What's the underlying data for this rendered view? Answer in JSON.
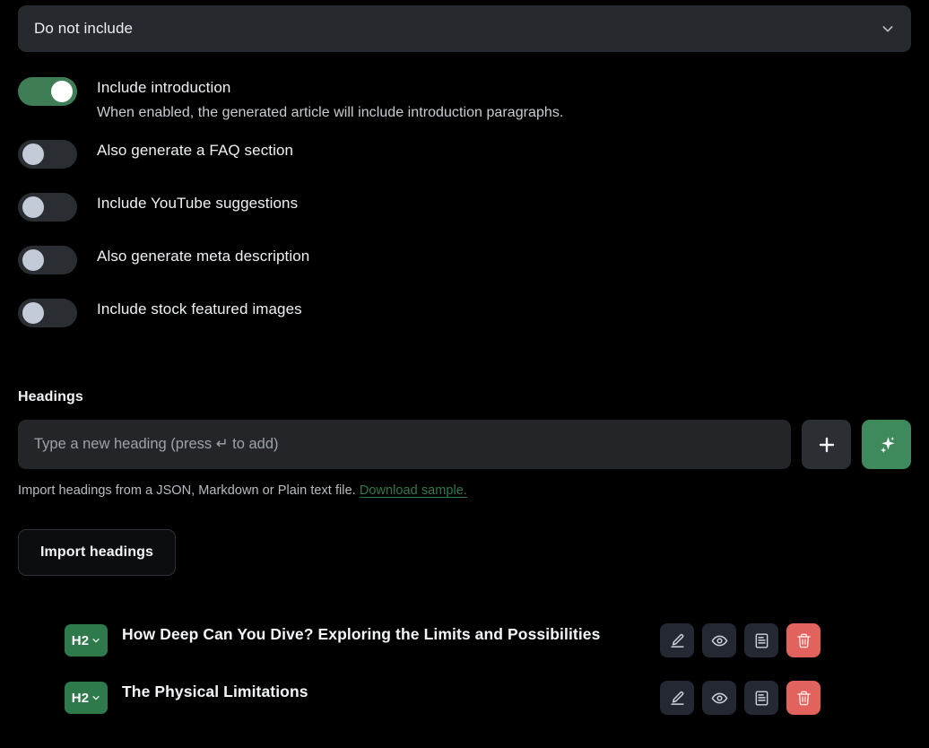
{
  "select": {
    "value": "Do not include",
    "chevron_icon": "chevron-down-icon"
  },
  "toggles": [
    {
      "label": "Include introduction",
      "description": "When enabled, the generated article will include introduction paragraphs.",
      "state": "on"
    },
    {
      "label": "Also generate a FAQ section",
      "description": "",
      "state": "off"
    },
    {
      "label": "Include YouTube suggestions",
      "description": "",
      "state": "off"
    },
    {
      "label": "Also generate meta description",
      "description": "",
      "state": "off"
    },
    {
      "label": "Include stock featured images",
      "description": "",
      "state": "off"
    }
  ],
  "headings": {
    "section_label": "Headings",
    "input_placeholder": "Type a new heading (press ↵ to add)",
    "input_value": "",
    "add_button_icon": "plus-icon",
    "generate_button_icon": "sparkle-icon",
    "import_hint_text": "Import headings from a JSON, Markdown or Plain text file.",
    "download_sample_label": "Download sample.",
    "import_button_label": "Import headings",
    "items": [
      {
        "level": "H2",
        "title": "How Deep Can You Dive? Exploring the Limits and Possibilities",
        "actions": [
          "edit-icon",
          "preview-icon",
          "notes-icon",
          "delete-icon"
        ]
      },
      {
        "level": "H2",
        "title": "The Physical Limitations",
        "actions": [
          "edit-icon",
          "preview-icon",
          "notes-icon",
          "delete-icon"
        ]
      }
    ]
  },
  "colors": {
    "background": "#000000",
    "accent_green": "#3f8a5c",
    "tag_green": "#2f7a4b",
    "danger_red": "#e2625e",
    "surface": "#26292d",
    "icon_surface": "#232833"
  }
}
